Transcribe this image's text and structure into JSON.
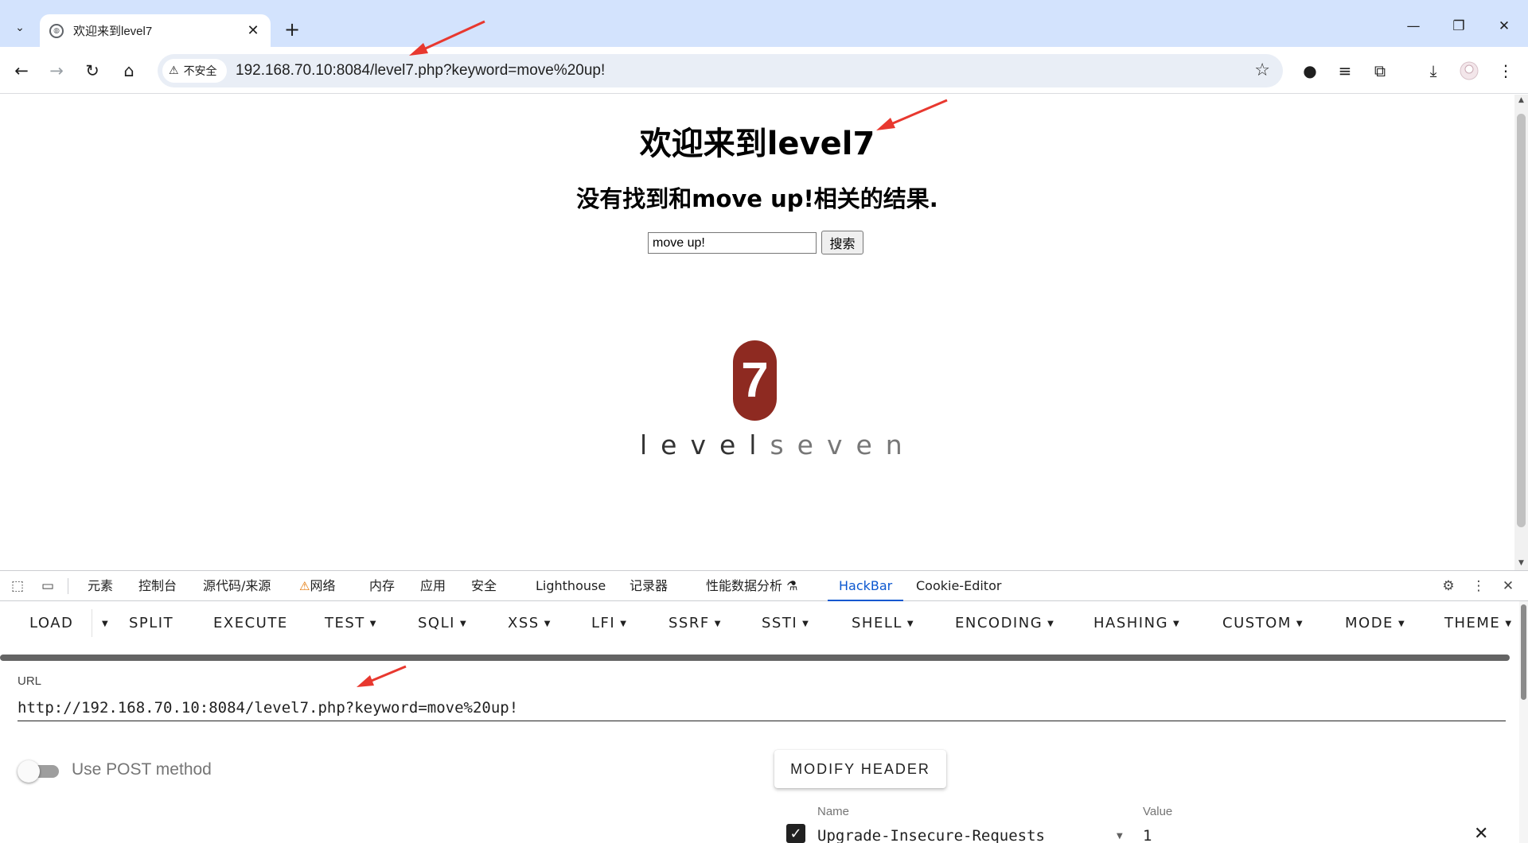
{
  "browser": {
    "tab_title": "欢迎来到level7",
    "security_label": "不安全",
    "address": "192.168.70.10:8084/level7.php?keyword=move%20up!",
    "icons": [
      "tab-search-icon",
      "globe-icon",
      "close-icon",
      "plus-icon",
      "back-icon",
      "forward-icon",
      "reload-icon",
      "home-icon",
      "warning-icon",
      "star-icon",
      "record-icon",
      "menu-icon",
      "extensions-icon",
      "download-icon",
      "avatar",
      "more-icon"
    ]
  },
  "page": {
    "heading": "欢迎来到level7",
    "result_text": "没有找到和move up!相关的结果.",
    "search_value": "move up!",
    "search_button": "搜索",
    "logo_number": "7",
    "logo_word_a": "level",
    "logo_word_b": "seven",
    "logo_colors": {
      "badge": "#8e2a21",
      "word_a": "#333333",
      "word_b": "#777777"
    }
  },
  "devtools": {
    "tabs": [
      "元素",
      "控制台",
      "源代码/来源",
      "网络",
      "内存",
      "应用",
      "安全",
      "Lighthouse",
      "记录器",
      "性能数据分析",
      "HackBar",
      "Cookie-Editor"
    ],
    "active_tab": "HackBar",
    "accent": "#0b57d0"
  },
  "hackbar": {
    "menu": {
      "load": "LOAD",
      "split": "SPLIT",
      "execute": "EXECUTE",
      "test": "TEST",
      "sqli": "SQLI",
      "xss": "XSS",
      "lfi": "LFI",
      "ssrf": "SSRF",
      "ssti": "SSTI",
      "shell": "SHELL",
      "encoding": "ENCODING",
      "hashing": "HASHING",
      "custom": "CUSTOM",
      "mode": "MODE",
      "theme": "THEME"
    },
    "url_label": "URL",
    "url_value": "http://192.168.70.10:8084/level7.php?keyword=move%20up!",
    "post_label": "Use POST method",
    "post_enabled": false,
    "modify_header": "MODIFY HEADER",
    "header_name_label": "Name",
    "header_value_label": "Value",
    "header_name": "Upgrade-Insecure-Requests",
    "header_value": "1",
    "header_enabled": true
  }
}
